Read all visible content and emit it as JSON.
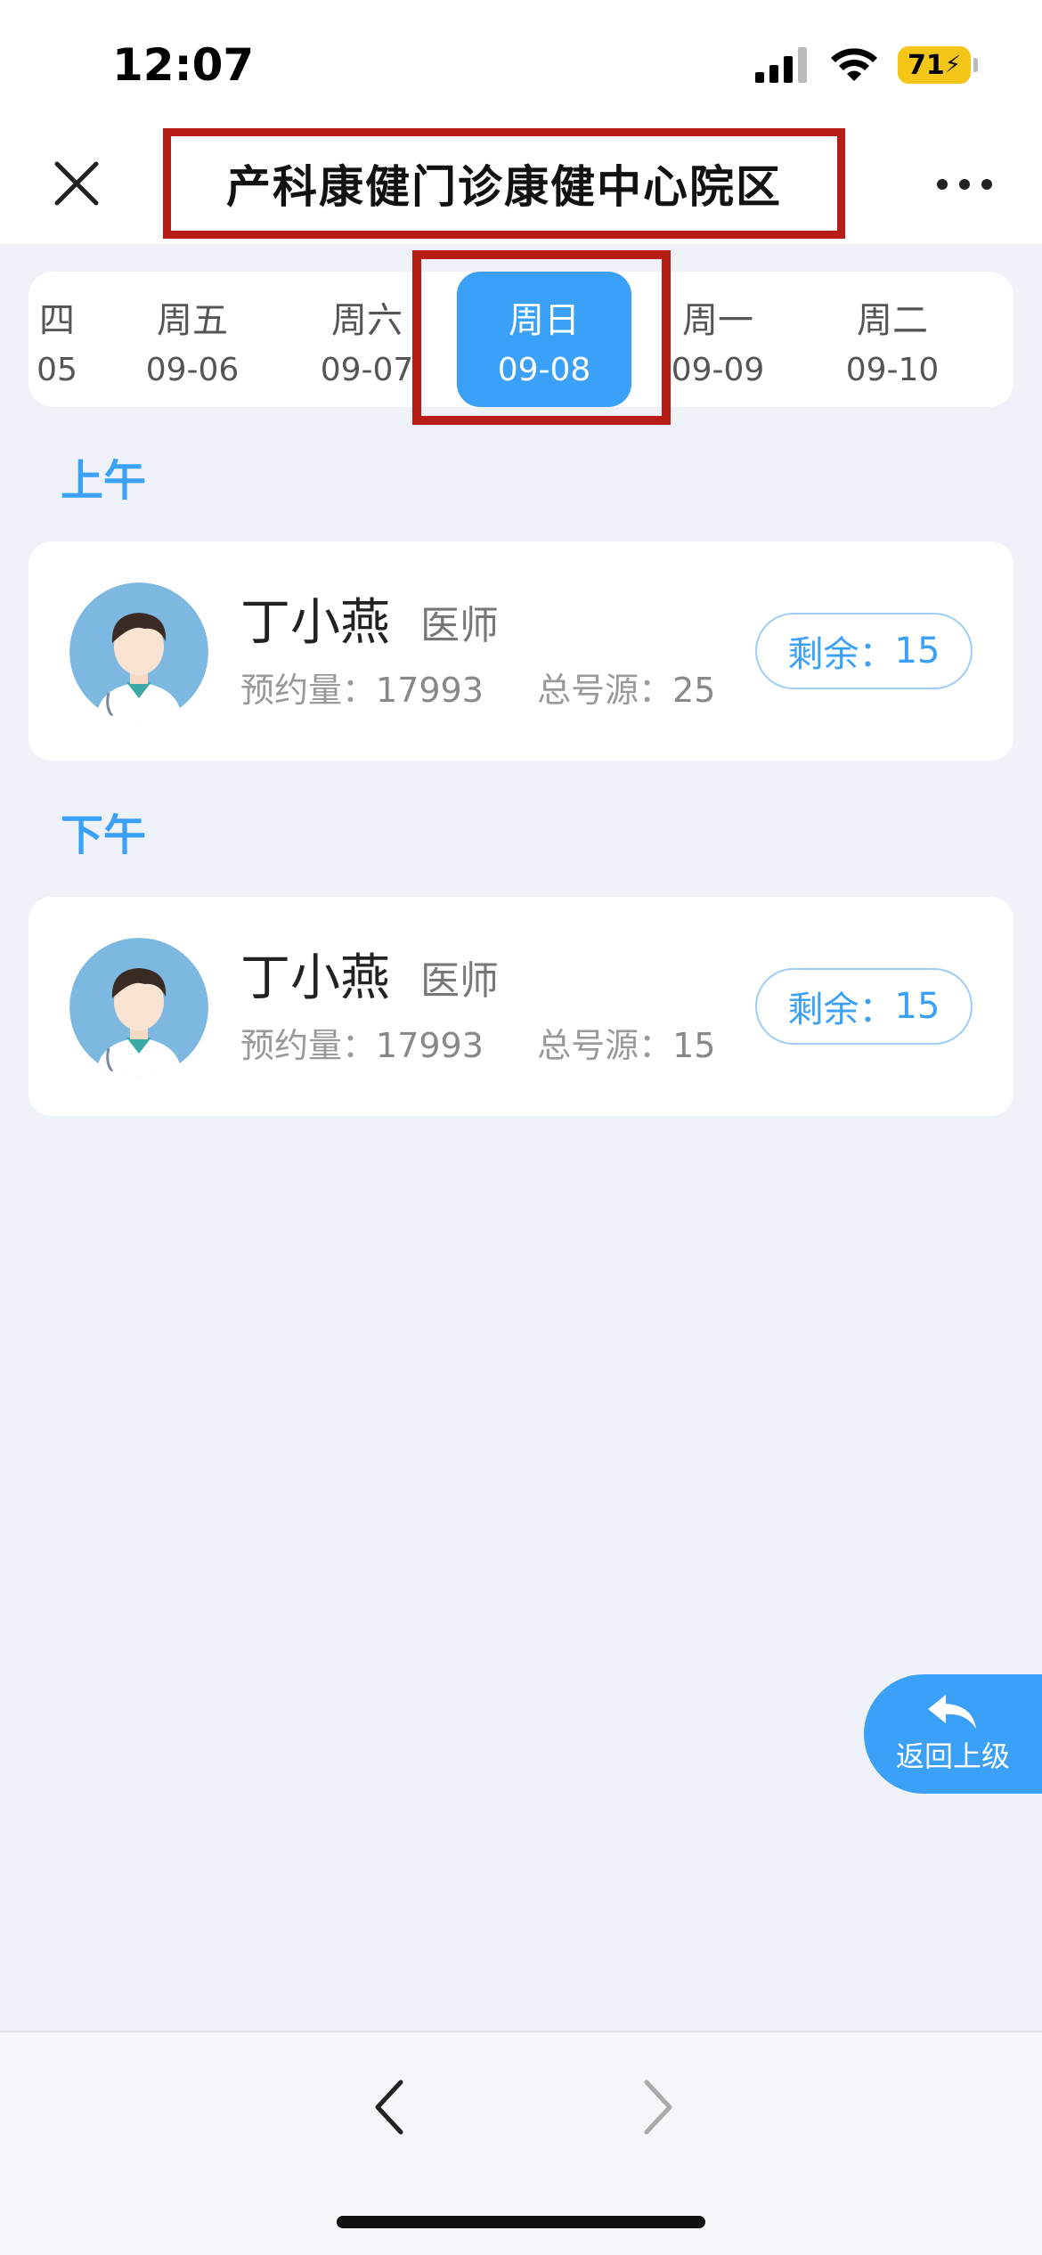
{
  "status_bar": {
    "time": "12:07",
    "battery": "71"
  },
  "nav": {
    "title": "产科康健门诊康健中心院区"
  },
  "dates": [
    {
      "week": "四",
      "day": "05"
    },
    {
      "week": "周五",
      "day": "09-06"
    },
    {
      "week": "周六",
      "day": "09-07"
    },
    {
      "week": "周日",
      "day": "09-08",
      "selected": true
    },
    {
      "week": "周一",
      "day": "09-09"
    },
    {
      "week": "周二",
      "day": "09-10"
    }
  ],
  "sections": [
    {
      "label": "上午",
      "doctor": {
        "name": "丁小燕",
        "title": "医师",
        "appointment_label": "预约量：",
        "appointment_value": "17993",
        "total_label": "总号源：",
        "total_value": "25",
        "remain_label": "剩余：",
        "remain_value": "15"
      }
    },
    {
      "label": "下午",
      "doctor": {
        "name": "丁小燕",
        "title": "医师",
        "appointment_label": "预约量：",
        "appointment_value": "17993",
        "total_label": "总号源：",
        "total_value": "15",
        "remain_label": "剩余：",
        "remain_value": "15"
      }
    }
  ],
  "back_button": {
    "label": "返回上级"
  },
  "colors": {
    "accent": "#3ba0f7",
    "highlight_box": "#b81c16",
    "background": "#eff3f9"
  }
}
